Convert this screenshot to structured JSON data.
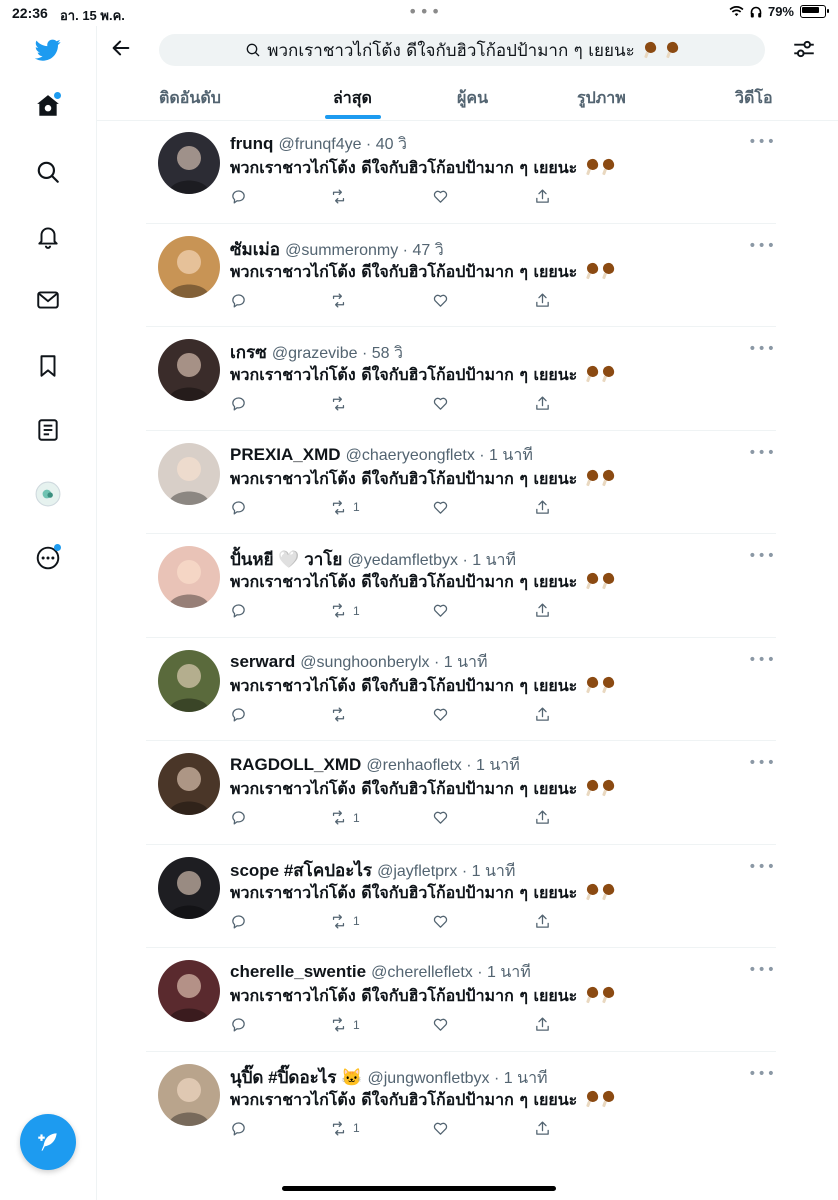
{
  "status_bar": {
    "time": "22:36",
    "date": "อา. 15 พ.ค.",
    "battery": "79%"
  },
  "search": {
    "query": "พวกเราชาวไก่โต้ง ดีใจกับฮิวโก้อปป้ามาก ๆ เยยนะ"
  },
  "tabs": [
    {
      "label": "ติดอันดับ"
    },
    {
      "label": "ล่าสุด"
    },
    {
      "label": "ผู้คน"
    },
    {
      "label": "รูปภาพ"
    },
    {
      "label": "วิดีโอ"
    }
  ],
  "colors": {
    "accent": "#1d9bf0",
    "text": "#0f1419",
    "muted": "#536471"
  },
  "tweets": [
    {
      "name": "frunq",
      "handle": "@frunqf4ye",
      "time": "40 วิ",
      "text": "พวกเราชาวไก่โต้ง ดีใจกับฮิวโก้อปป้ามาก ๆ เยยนะ",
      "retweets": "",
      "avatar_color": "#2c2c34"
    },
    {
      "name": "ซัมเม่อ",
      "handle": "@summeronmy",
      "time": "47 วิ",
      "text": "พวกเราชาวไก่โต้ง ดีใจกับฮิวโก้อปป้ามาก ๆ เยยนะ",
      "retweets": "",
      "avatar_color": "#c89455"
    },
    {
      "name": "เกรซ",
      "handle": "@grazevibe",
      "time": "58 วิ",
      "text": "พวกเราชาวไก่โต้ง ดีใจกับฮิวโก้อปป้ามาก ๆ เยยนะ",
      "retweets": "",
      "avatar_color": "#3a2c2a"
    },
    {
      "name": "PREXIA_XMD",
      "handle": "@chaeryeongfletx",
      "time": "1 นาที",
      "text": "พวกเราชาวไก่โต้ง ดีใจกับฮิวโก้อปป้ามาก ๆ เยยนะ",
      "retweets": "1",
      "avatar_color": "#d8cfc8"
    },
    {
      "name": "ปั้นหยี 🤍 วาโย",
      "handle": "@yedamfletbyx",
      "time": "1 นาที",
      "text": "พวกเราชาวไก่โต้ง ดีใจกับฮิวโก้อปป้ามาก ๆ เยยนะ",
      "retweets": "1",
      "avatar_color": "#e9c3b7"
    },
    {
      "name": "serward",
      "handle": "@sunghoonberylx",
      "time": "1 นาที",
      "text": "พวกเราชาวไก่โต้ง ดีใจกับฮิวโก้อปป้ามาก ๆ เยยนะ",
      "retweets": "",
      "avatar_color": "#5a6a3c"
    },
    {
      "name": "RAGDOLL_XMD",
      "handle": "@renhaofletx",
      "time": "1 นาที",
      "text": "พวกเราชาวไก่โต้ง ดีใจกับฮิวโก้อปป้ามาก ๆ เยยนะ",
      "retweets": "1",
      "avatar_color": "#4a3628"
    },
    {
      "name": "scope #สโคปอะไร",
      "handle": "@jayfletprx",
      "time": "1 นาที",
      "text": "พวกเราชาวไก่โต้ง ดีใจกับฮิวโก้อปป้ามาก ๆ เยยนะ",
      "retweets": "1",
      "avatar_color": "#1e1e22"
    },
    {
      "name": "cherelle_swentie",
      "handle": "@cherellefletx",
      "time": "1 นาที",
      "text": "พวกเราชาวไก่โต้ง ดีใจกับฮิวโก้อปป้ามาก ๆ เยยนะ",
      "retweets": "1",
      "avatar_color": "#5a2a2e"
    },
    {
      "name": "นุปิ๊ด #ปิ๊ดอะไร 🐱",
      "handle": "@jungwonfletbyx",
      "time": "1 นาที",
      "text": "พวกเราชาวไก่โต้ง ดีใจกับฮิวโก้อปป้ามาก ๆ เยยนะ",
      "retweets": "1",
      "avatar_color": "#b9a48c"
    }
  ]
}
